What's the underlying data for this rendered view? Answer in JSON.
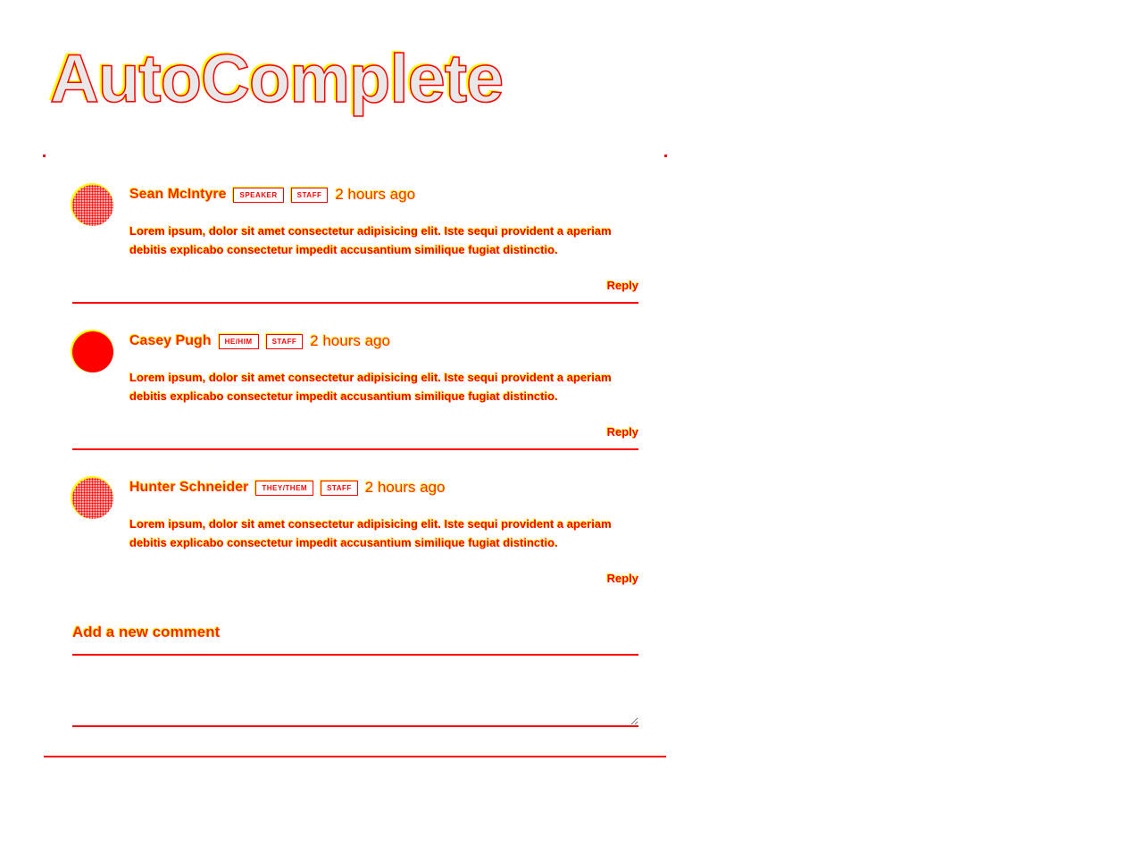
{
  "page": {
    "title": "AutoComplete"
  },
  "comments": [
    {
      "author": "Sean McIntyre",
      "badges": [
        "SPEAKER",
        "STAFF"
      ],
      "time": "2 hours ago",
      "body": "Lorem ipsum, dolor sit amet consectetur adipisicing elit. Iste sequi provident a aperiam debitis explicabo consectetur impedit accusantium similique fugiat distinctio.",
      "reply_label": "Reply"
    },
    {
      "author": "Casey Pugh",
      "badges": [
        "HE/HIM",
        "STAFF"
      ],
      "time": "2 hours ago",
      "body": "Lorem ipsum, dolor sit amet consectetur adipisicing elit. Iste sequi provident a aperiam debitis explicabo consectetur impedit accusantium similique fugiat distinctio.",
      "reply_label": "Reply"
    },
    {
      "author": "Hunter Schneider",
      "badges": [
        "THEY/THEM",
        "STAFF"
      ],
      "time": "2 hours ago",
      "body": "Lorem ipsum, dolor sit amet consectetur adipisicing elit. Iste sequi provident a aperiam debitis explicabo consectetur impedit accusantium similique fugiat distinctio.",
      "reply_label": "Reply"
    }
  ],
  "new_comment": {
    "label": "Add a new comment",
    "value": "",
    "placeholder": ""
  },
  "colors": {
    "outline": "#ff0000",
    "highlight": "#ffff00",
    "title_fill": "#e8e8e8"
  }
}
